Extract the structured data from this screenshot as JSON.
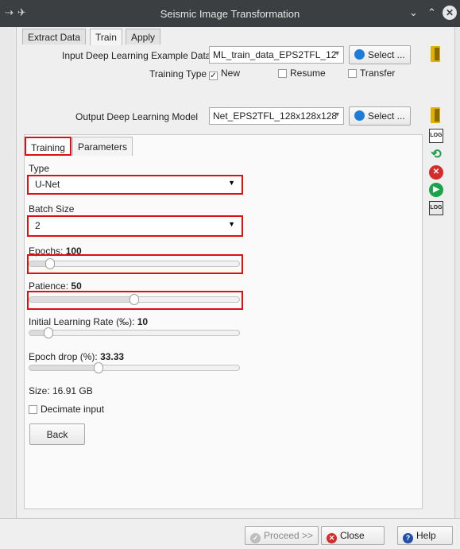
{
  "window": {
    "title": "Seismic Image Transformation"
  },
  "main_tabs": [
    "Extract Data",
    "Train",
    "Apply"
  ],
  "active_main_tab": "Train",
  "input_data": {
    "label": "Input Deep Learning Example Data",
    "value": "ML_train_data_EPS2TFL_12",
    "select_label": "Select ..."
  },
  "training_type": {
    "label": "Training Type",
    "options": [
      {
        "label": "New",
        "checked": true
      },
      {
        "label": "Resume",
        "checked": false
      },
      {
        "label": "Transfer",
        "checked": false
      }
    ]
  },
  "output_model": {
    "label": "Output Deep Learning Model",
    "value": "Net_EPS2TFL_128x128x128",
    "select_label": "Select ..."
  },
  "sub_tabs": [
    "Training",
    "Parameters"
  ],
  "active_sub_tab": "Training",
  "training": {
    "type_label": "Type",
    "type_value": "U-Net",
    "batch_label": "Batch Size",
    "batch_value": "2",
    "epochs_label": "Epochs:",
    "epochs_value": "100",
    "epochs_fraction": 0.1,
    "patience_label": "Patience:",
    "patience_value": "50",
    "patience_fraction": 0.5,
    "lr_label": "Initial Learning Rate (‰):",
    "lr_value": "10",
    "lr_fraction": 0.09,
    "drop_label": "Epoch drop (%):",
    "drop_value": "33.33",
    "drop_fraction": 0.33,
    "size_text": "Size: 16.91 GB",
    "decimate_label": "Decimate input",
    "decimate_checked": false,
    "back_label": "Back"
  },
  "side_icons": [
    "log-icon",
    "refresh-icon",
    "stop-icon",
    "run-icon",
    "log-view-icon"
  ],
  "side_icon_text": {
    "log": "LOG",
    "logview": "LOG"
  },
  "footer": {
    "proceed": "Proceed >>",
    "close": "Close",
    "help": "Help"
  },
  "colors": {
    "accent_blue": "#1f7bd8",
    "stop_red": "#d52b2b",
    "run_green": "#1aa34a",
    "highlight_red": "#dd1111",
    "titlebar": "#3c3f41"
  }
}
